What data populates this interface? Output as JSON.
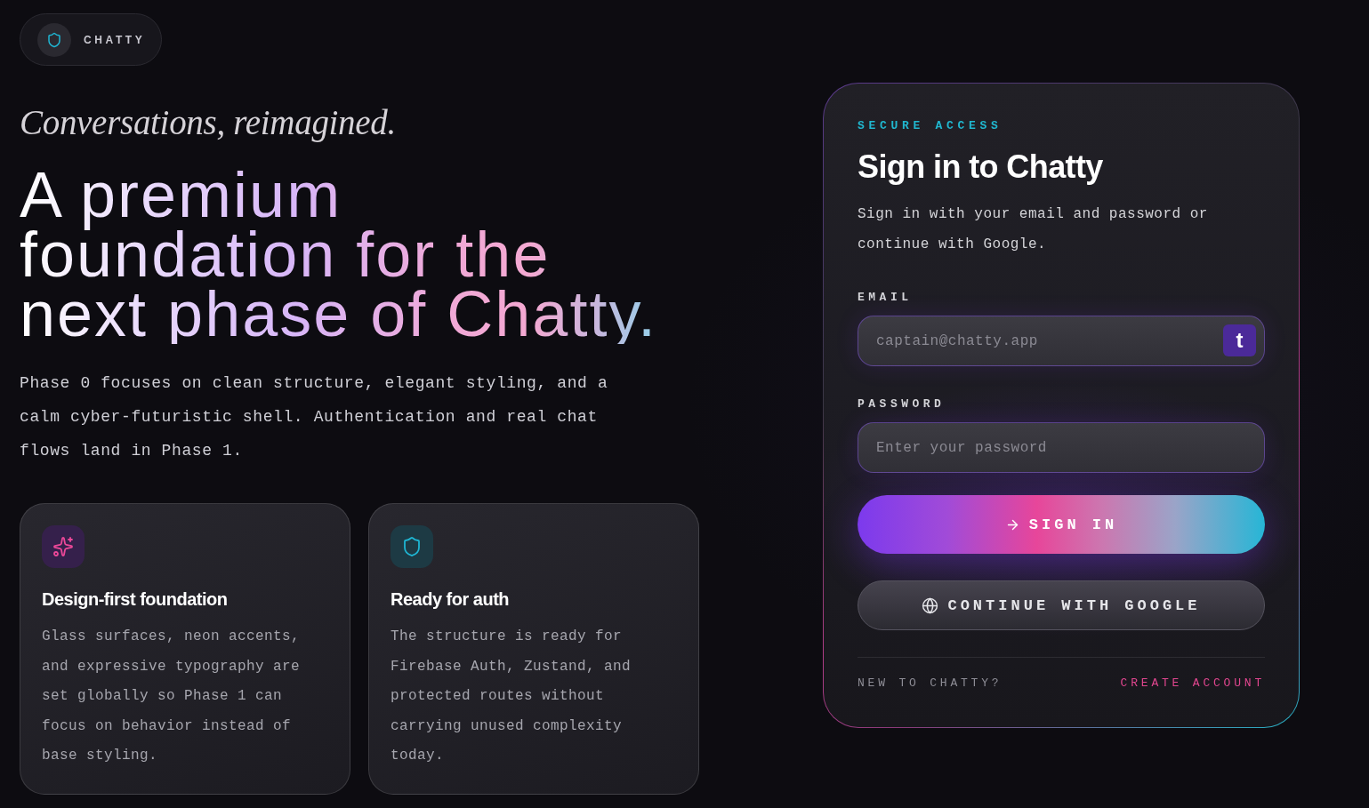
{
  "brand": {
    "name": "CHATTY"
  },
  "hero": {
    "tagline": "Conversations, reimagined.",
    "headline": "A premium foundation for the next phase of Chatty.",
    "description": "Phase 0 focuses on clean structure, elegant styling, and a calm cyber-futuristic shell. Authentication and real chat flows land in Phase 1."
  },
  "features": [
    {
      "kind": "sparkles",
      "title": "Design-first foundation",
      "body": "Glass surfaces, neon accents, and expressive typography are set globally so Phase 1 can focus on behavior instead of base styling."
    },
    {
      "kind": "shield",
      "title": "Ready for auth",
      "body": "The structure is ready for Firebase Auth, Zustand, and protected routes without carrying unused complexity today."
    }
  ],
  "auth": {
    "eyebrow": "SECURE ACCESS",
    "title": "Sign in to Chatty",
    "description": "Sign in with your email and password or continue with Google.",
    "fields": [
      {
        "label": "EMAIL",
        "placeholder": "captain@chatty.app",
        "badge": "t"
      },
      {
        "label": "PASSWORD",
        "placeholder": "Enter your password"
      }
    ],
    "primary_button": {
      "label": "SIGN IN"
    },
    "google_button": {
      "label": "CONTINUE WITH GOOGLE"
    },
    "footer": {
      "prompt": "NEW TO CHATTY?",
      "link": "CREATE ACCOUNT"
    }
  }
}
